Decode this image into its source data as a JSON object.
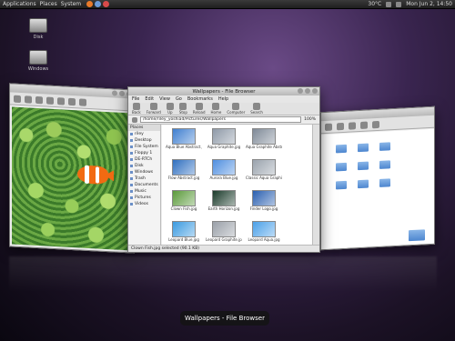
{
  "panel": {
    "menus": [
      "Applications",
      "Places",
      "System"
    ],
    "clock": "Mon Jun 2, 14:50",
    "temp": "30°C"
  },
  "desktop_icons": [
    {
      "label": "Disk"
    },
    {
      "label": "Windows"
    }
  ],
  "viewer": {
    "title": ""
  },
  "browser": {
    "title": "Wallpapers - File Browser",
    "menus": [
      "File",
      "Edit",
      "View",
      "Go",
      "Bookmarks",
      "Help"
    ],
    "toolbar": [
      "Back",
      "Forward",
      "Up",
      "Stop",
      "Reload",
      "Home",
      "Computer",
      "Search"
    ],
    "location": "/home/riley_yoshiad/Pictures/Wallpapers",
    "zoom": "100%",
    "sidebar_header": "Places",
    "sidebar_items": [
      "riley",
      "Desktop",
      "File System",
      "Floppy 1",
      "DE-RTCh",
      "Disk",
      "Windows",
      "Trash",
      "Documents",
      "Music",
      "Pictures",
      "Videos"
    ],
    "thumbnails": [
      {
        "caption": "Aqua Blue Abstract.jpg",
        "color": "#3f7fd0"
      },
      {
        "caption": "Aqua Graphite.jpg",
        "color": "#8f9aa8"
      },
      {
        "caption": "Aqua Graphite Abstract.jpg",
        "color": "#7f8a98"
      },
      {
        "caption": "Flow Abstract.jpg",
        "color": "#2f6fc0"
      },
      {
        "caption": "Aurora Blue.jpg",
        "color": "#4f8fe0"
      },
      {
        "caption": "Classic Aqua Graphite.jpg",
        "color": "#9aa3ad"
      },
      {
        "caption": "Clown Fish.jpg",
        "color": "#5a9a3a"
      },
      {
        "caption": "Earth Horizon.jpg",
        "color": "#1a3a2a"
      },
      {
        "caption": "Finder Logo.jpg",
        "color": "#2a5fb0"
      },
      {
        "caption": "Leopard Blue.jpg",
        "color": "#3a9ae0"
      },
      {
        "caption": "Leopard Graphite.jpg",
        "color": "#9aa0a8"
      },
      {
        "caption": "Leopard Aqua.jpg",
        "color": "#4aa0e8"
      }
    ],
    "status": "Clown Fish.jpg selected (90.1 KB)"
  },
  "switcher": {
    "label": "Wallpapers - File Browser"
  }
}
